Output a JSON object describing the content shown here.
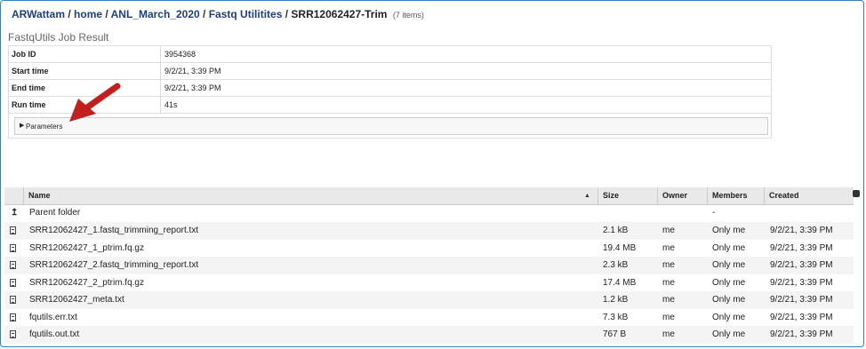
{
  "breadcrumb": {
    "items": [
      "ARWattam",
      "home",
      "ANL_March_2020",
      "Fastq Utilitites"
    ],
    "current": "SRR12062427-Trim",
    "count": "(7 items)"
  },
  "job": {
    "title": "FastqUtils Job Result",
    "rows": [
      {
        "key": "Job ID",
        "value": "3954368"
      },
      {
        "key": "Start time",
        "value": "9/2/21, 3:39 PM"
      },
      {
        "key": "End time",
        "value": "9/2/21, 3:39 PM"
      },
      {
        "key": "Run time",
        "value": "41s"
      }
    ],
    "parameters_label": "Parameters"
  },
  "annotation": {
    "color": "#c0201e",
    "icon": "red-arrow-icon"
  },
  "files": {
    "columns": {
      "name": "Name",
      "size": "Size",
      "owner": "Owner",
      "members": "Members",
      "created": "Created"
    },
    "parent": {
      "name": "Parent folder",
      "members": "-"
    },
    "rows": [
      {
        "name": "SRR12062427_1.fastq_trimming_report.txt",
        "size": "2.1 kB",
        "owner": "me",
        "members": "Only me",
        "created": "9/2/21, 3:39 PM"
      },
      {
        "name": "SRR12062427_1_ptrim.fq.gz",
        "size": "19.4 MB",
        "owner": "me",
        "members": "Only me",
        "created": "9/2/21, 3:39 PM"
      },
      {
        "name": "SRR12062427_2.fastq_trimming_report.txt",
        "size": "2.3 kB",
        "owner": "me",
        "members": "Only me",
        "created": "9/2/21, 3:39 PM"
      },
      {
        "name": "SRR12062427_2_ptrim.fq.gz",
        "size": "17.4 MB",
        "owner": "me",
        "members": "Only me",
        "created": "9/2/21, 3:39 PM"
      },
      {
        "name": "SRR12062427_meta.txt",
        "size": "1.2 kB",
        "owner": "me",
        "members": "Only me",
        "created": "9/2/21, 3:39 PM"
      },
      {
        "name": "fqutils.err.txt",
        "size": "7.3 kB",
        "owner": "me",
        "members": "Only me",
        "created": "9/2/21, 3:39 PM"
      },
      {
        "name": "fqutils.out.txt",
        "size": "767 B",
        "owner": "me",
        "members": "Only me",
        "created": "9/2/21, 3:39 PM"
      }
    ]
  }
}
